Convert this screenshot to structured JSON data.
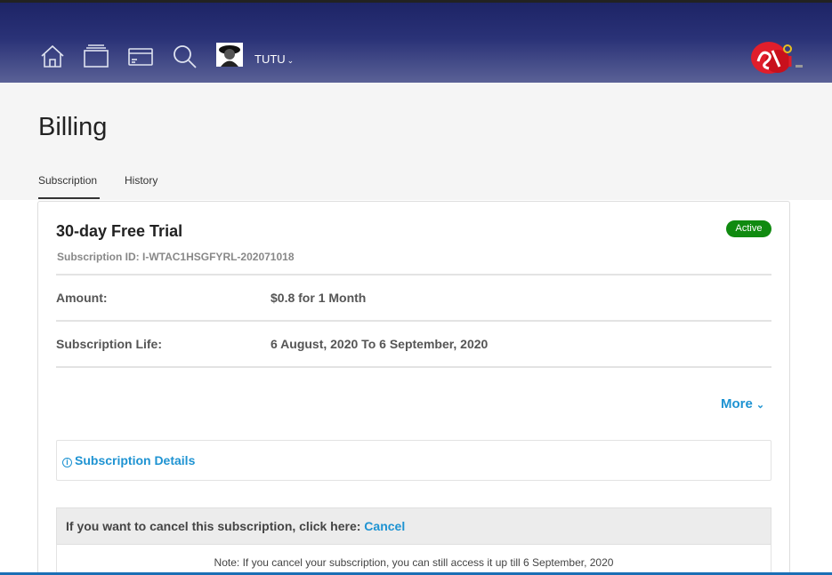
{
  "header": {
    "username": "TUTU",
    "nav_icons": [
      "home-icon",
      "cards-icon",
      "credit-card-icon",
      "search-icon"
    ],
    "colors": {
      "top": "#1d2466",
      "bottom": "#5a6196"
    }
  },
  "page": {
    "title": "Billing",
    "tabs": [
      {
        "label": "Subscription",
        "active": true
      },
      {
        "label": "History",
        "active": false
      }
    ]
  },
  "subscription": {
    "plan_name": "30-day Free Trial",
    "status": "Active",
    "status_color": "#108a10",
    "id_text": "Subscription ID: I-WTAC1HSGFYRL-202071018",
    "rows": [
      {
        "label": "Amount:",
        "value": "$0.8 for 1 Month"
      },
      {
        "label": "Subscription Life:",
        "value": "6 August, 2020 To 6 September, 2020"
      }
    ],
    "more_label": "More",
    "details_label": "Subscription Details",
    "cancel_prompt": "If you want to cancel this subscription, click here:",
    "cancel_label": "Cancel",
    "note": "Note: If you cancel your subscription, you can still access it up till 6 September, 2020",
    "link_color": "#1e93d2"
  }
}
